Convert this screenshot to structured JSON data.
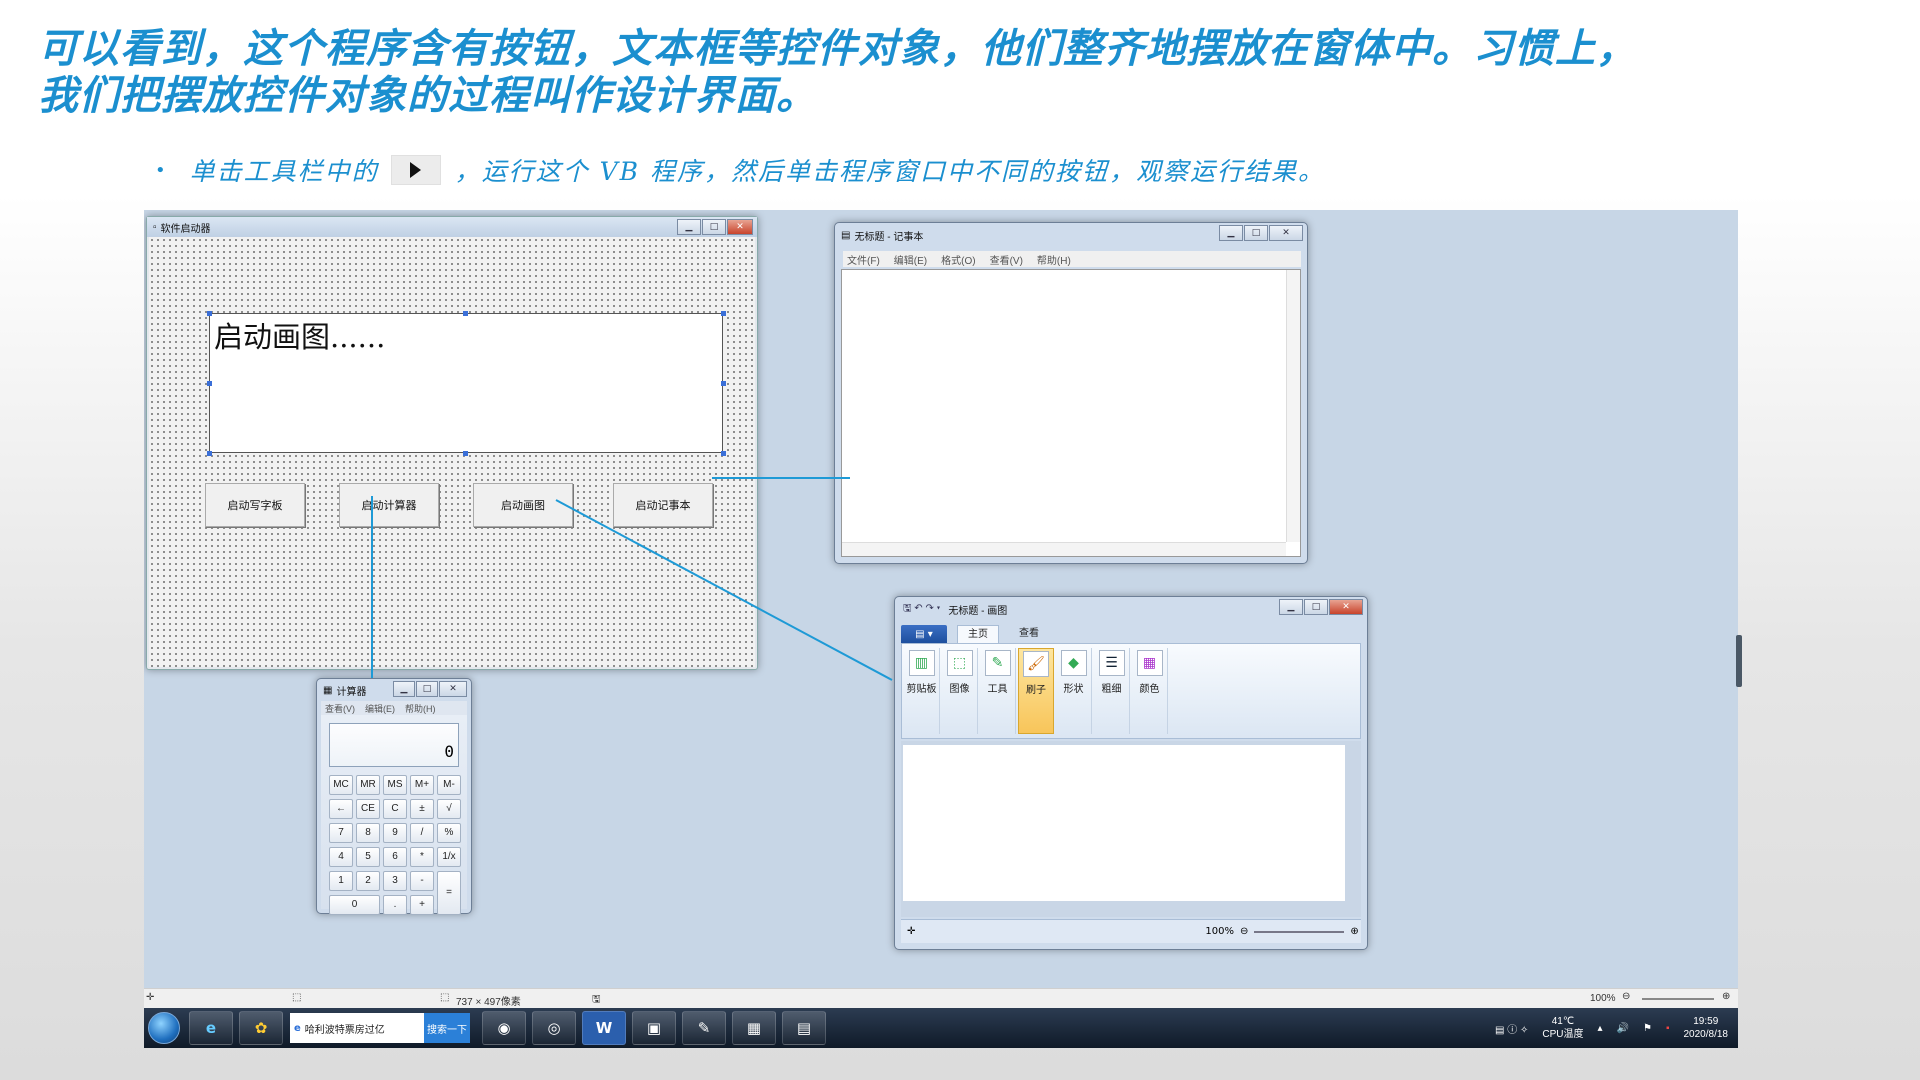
{
  "slide": {
    "title_line1": "可以看到，这个程序含有按钮，文本框等控件对象，他们整齐地摆放在窗体中。习惯上，",
    "title_line2": "我们把摆放控件对象的过程叫作设计界面。",
    "bullet_prefix": "单击工具栏中的",
    "bullet_suffix": "，运行这个 VB 程序，然后单击程序窗口中不同的按钮，观察运行结果。",
    "run_icon": "play-icon"
  },
  "vbform": {
    "title": "软件启动器",
    "textbox_text": "启动画图......",
    "buttons": [
      "启动写字板",
      "启动计算器",
      "启动画图",
      "启动记事本"
    ]
  },
  "notepad": {
    "title": "无标题 - 记事本",
    "menu": [
      "文件(F)",
      "编辑(E)",
      "格式(O)",
      "查看(V)",
      "帮助(H)"
    ]
  },
  "paint": {
    "title": "无标题 - 画图",
    "tabs": [
      "主页",
      "查看"
    ],
    "groups": [
      "剪贴板",
      "图像",
      "工具",
      "刷子",
      "形状",
      "粗细",
      "颜色"
    ],
    "zoom": "100%"
  },
  "calculator": {
    "title": "计算器",
    "menu": [
      "查看(V)",
      "编辑(E)",
      "帮助(H)"
    ],
    "display": "0",
    "keys": [
      [
        "MC",
        "MR",
        "MS",
        "M+",
        "M-"
      ],
      [
        "←",
        "CE",
        "C",
        "±",
        "√"
      ],
      [
        "7",
        "8",
        "9",
        "/",
        "%"
      ],
      [
        "4",
        "5",
        "6",
        "*",
        "1/x"
      ],
      [
        "1",
        "2",
        "3",
        "-",
        "="
      ],
      [
        "0",
        ".",
        "+"
      ]
    ]
  },
  "ide_status": {
    "size": "737 × 497像素",
    "zoom": "100%"
  },
  "taskbar": {
    "search_text": "哈利波特票房过亿",
    "search_button": "搜索一下",
    "temp": "41℃",
    "cpu_label": "CPU温度",
    "time": "19:59",
    "date": "2020/8/18"
  },
  "colors": {
    "accent": "#1b8fcf",
    "connector": "#1e9ad6"
  }
}
